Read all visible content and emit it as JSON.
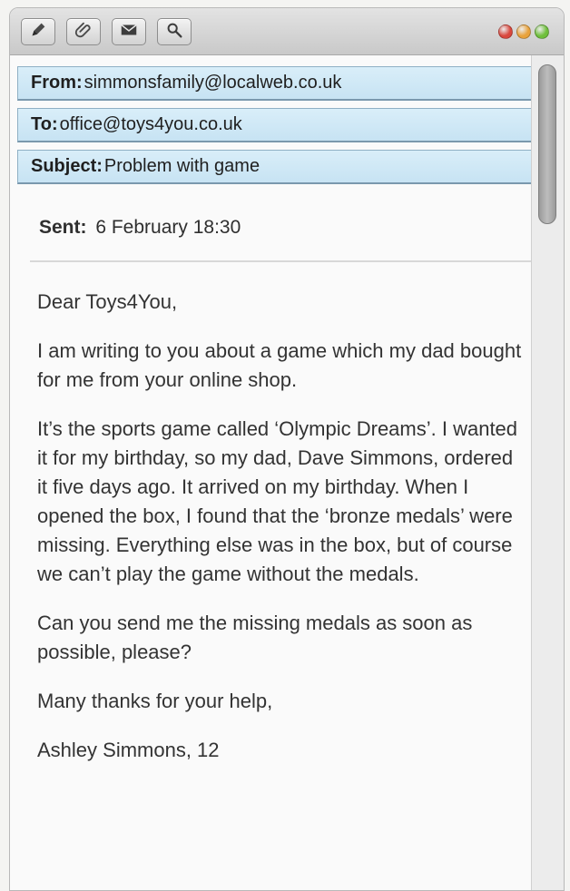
{
  "toolbar": {
    "tools": [
      {
        "icon": "pencil-icon"
      },
      {
        "icon": "paperclip-icon"
      },
      {
        "icon": "envelope-icon"
      },
      {
        "icon": "magnifier-icon"
      }
    ],
    "window_lights": [
      "#d9473d",
      "#e9a23b",
      "#6fbf3c"
    ]
  },
  "header": {
    "from_label": "From:",
    "from_value": "simmonsfamily@localweb.co.uk",
    "to_label": "To:",
    "to_value": "office@toys4you.co.uk",
    "subject_label": "Subject:",
    "subject_value": "Problem with game"
  },
  "sent": {
    "label": "Sent:",
    "value": "6 February 18:30"
  },
  "message": {
    "greeting": "Dear Toys4You,",
    "paragraphs": [
      "I am writing to you about a game which my dad bought for me from your online shop.",
      "It’s the sports game called ‘Olympic Dreams’. I wanted it for my birthday, so my dad, Dave Simmons, ordered it five days ago. It arrived on my birthday. When I opened the box, I found that the ‘bronze medals’ were missing. Everything else was in the box, but of course we can’t play the game without the medals.",
      "Can you send me the missing medals as soon as possible, please?"
    ],
    "closing": "Many thanks for your help,",
    "signature": "Ashley Simmons, 12"
  },
  "colors": {
    "header_bg": "#d2e9f6",
    "header_border": "#7a98ad"
  }
}
